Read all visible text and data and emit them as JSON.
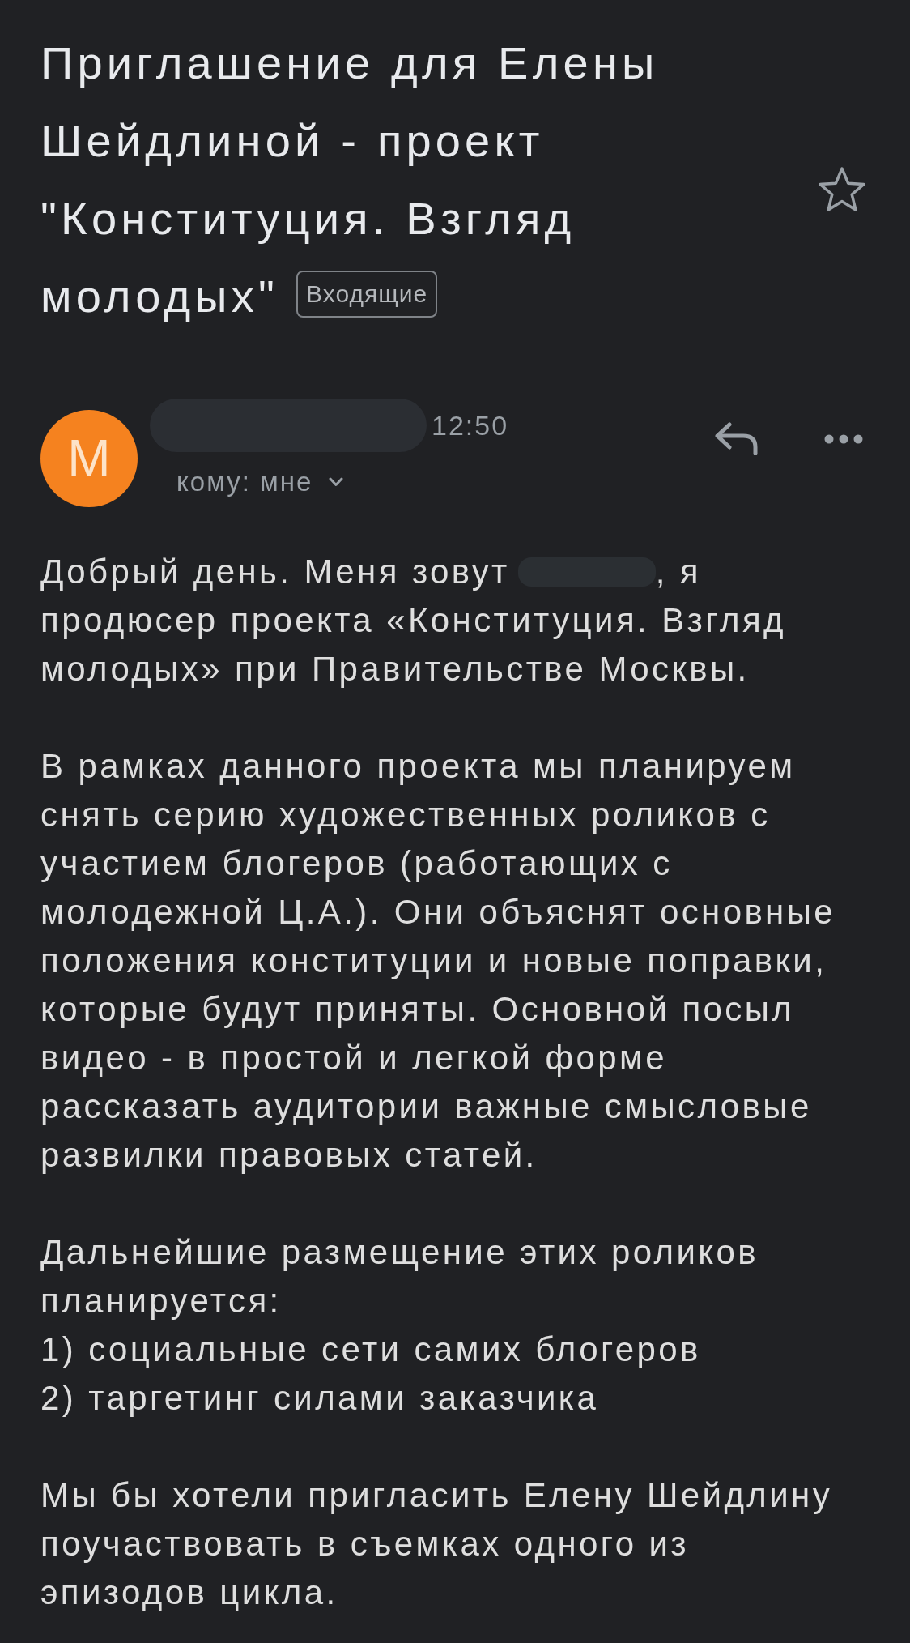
{
  "subject": {
    "text": "Приглашение для Елены Шейдлиной - проект \"Конституция. Взгляд молодых\"",
    "label": "Входящие",
    "starred": false
  },
  "message": {
    "avatar_letter": "М",
    "sender_redacted": true,
    "time": "12:50",
    "recipient": "кому: мне"
  },
  "body": [
    {
      "kind": "mixed",
      "parts": [
        {
          "kind": "text",
          "text": "Добрый день. Меня зовут"
        },
        {
          "kind": "redaction"
        },
        {
          "kind": "text",
          "text": ", я продюсер проекта «Конституция. Взгляд молодых» при Правительстве Москвы."
        }
      ]
    },
    {
      "kind": "text",
      "text": "В рамках данного проекта мы планируем снять серию художественных роликов с участием блогеров (работающих с молодежной Ц.А.). Они объяснят основные положения конституции и новые поправки, которые будут приняты. Основной посыл видео - в простой и легкой форме рассказать аудитории важные смысловые развилки правовых статей."
    },
    {
      "kind": "list",
      "intro": "Дальнейшие размещение этих роликов планируется:",
      "items": [
        "1) социальные сети самих блогеров",
        "2) таргетинг силами заказчика"
      ]
    },
    {
      "kind": "text",
      "text": "Мы бы хотели пригласить Елену Шейдлину поучаствовать в съемках одного из эпизодов цикла."
    }
  ]
}
